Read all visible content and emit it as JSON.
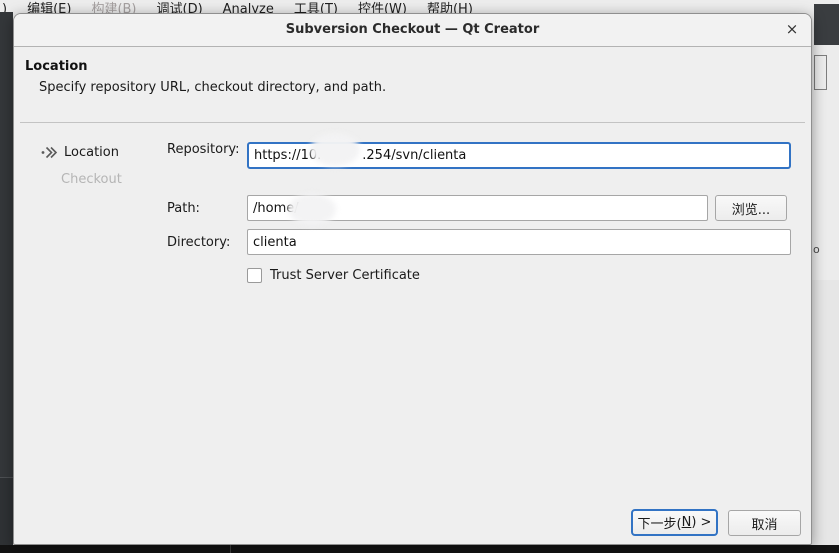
{
  "menubar": {
    "items": [
      {
        "label": ")",
        "muted": false
      },
      {
        "label": "编辑(E)",
        "muted": false
      },
      {
        "label": "构建(B)",
        "muted": true
      },
      {
        "label": "调试(D)",
        "muted": false
      },
      {
        "label": "Analyze",
        "muted": false
      },
      {
        "label": "工具(T)",
        "muted": false
      },
      {
        "label": "控件(W)",
        "muted": false
      },
      {
        "label": "帮助(H)",
        "muted": false
      }
    ]
  },
  "dialog": {
    "title": "Subversion Checkout — Qt Creator",
    "close_icon": "×",
    "header": {
      "title": "Location",
      "subtitle": "Specify repository URL, checkout directory, and path."
    },
    "steps": {
      "current": {
        "label": "Location"
      },
      "next": {
        "label": "Checkout"
      }
    },
    "form": {
      "repository": {
        "label": "Repository:",
        "value_prefix": "https://10.",
        "value_suffix": ".254/svn/clienta"
      },
      "path": {
        "label": "Path:",
        "value_prefix": "/home/",
        "browse_label": "浏览..."
      },
      "directory": {
        "label": "Directory:",
        "value": "clienta"
      },
      "trust_checkbox": {
        "label": "Trust Server Certificate",
        "checked": false
      }
    },
    "buttons": {
      "next": {
        "pre": "下一步(",
        "accel": "N",
        "post": ") >"
      },
      "cancel": "取消"
    }
  },
  "background": {
    "right_fragment": "o"
  },
  "colors": {
    "focus_accent": "#3273c4",
    "dialog_bg": "#efefef",
    "titlebar_bg": "#f2f2f2",
    "left_strip": "#34373a",
    "bottom_strip": "#131313",
    "menubar_bg": "#ededed"
  }
}
